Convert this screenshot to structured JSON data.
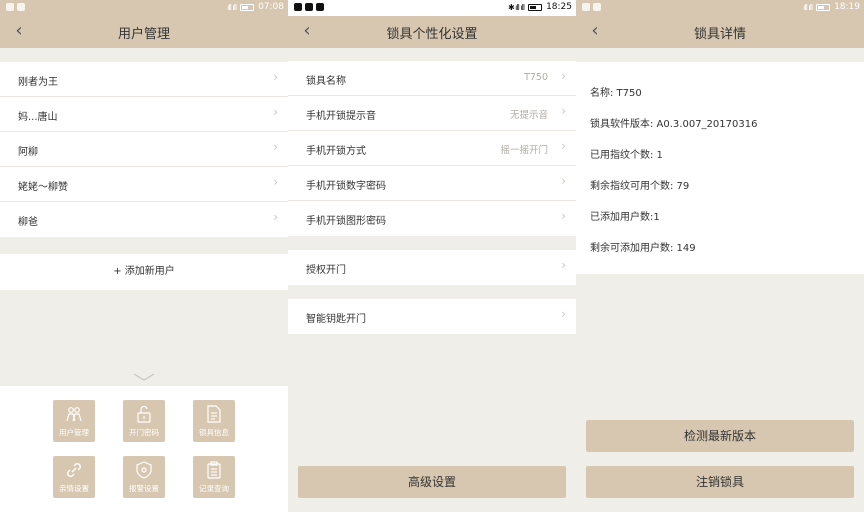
{
  "colors": {
    "accent": "#d7c7b0",
    "background": "#efeee9",
    "text": "#333333"
  },
  "screen1": {
    "status_time": "07:08",
    "title": "用户管理",
    "users": [
      "刚者为王",
      "妈...唐山",
      "阿柳",
      "姥姥～柳赞",
      "柳爸"
    ],
    "add_user": "+ 添加新用户",
    "grid": [
      {
        "label": "用户管理",
        "icon": "users-icon"
      },
      {
        "label": "开门密码",
        "icon": "unlock-icon"
      },
      {
        "label": "锁具信息",
        "icon": "document-icon"
      },
      {
        "label": "亲情设置",
        "icon": "link-icon"
      },
      {
        "label": "报警设置",
        "icon": "shield-icon"
      },
      {
        "label": "记录查询",
        "icon": "clipboard-icon"
      }
    ]
  },
  "screen2": {
    "status_time": "18:25",
    "title": "锁具个性化设置",
    "rows": [
      {
        "label": "锁具名称",
        "value": "T750"
      },
      {
        "label": "手机开锁提示音",
        "value": "无提示音"
      },
      {
        "label": "手机开锁方式",
        "value": "摇一摇开门"
      },
      {
        "label": "手机开锁数字密码",
        "value": ""
      },
      {
        "label": "手机开锁图形密码",
        "value": ""
      }
    ],
    "authorized_open": "授权开门",
    "smart_key_open": "智能钥匙开门",
    "advanced_button": "高级设置"
  },
  "screen3": {
    "status_time": "18:19",
    "title": "锁具详情",
    "details": [
      "名称: T750",
      "锁具软件版本: A0.3.007_20170316",
      "已用指纹个数: 1",
      "剩余指纹可用个数: 79",
      "已添加用户数:1",
      "剩余可添加用户数: 149"
    ],
    "check_update_button": "检测最新版本",
    "deregister_button": "注销锁具"
  }
}
